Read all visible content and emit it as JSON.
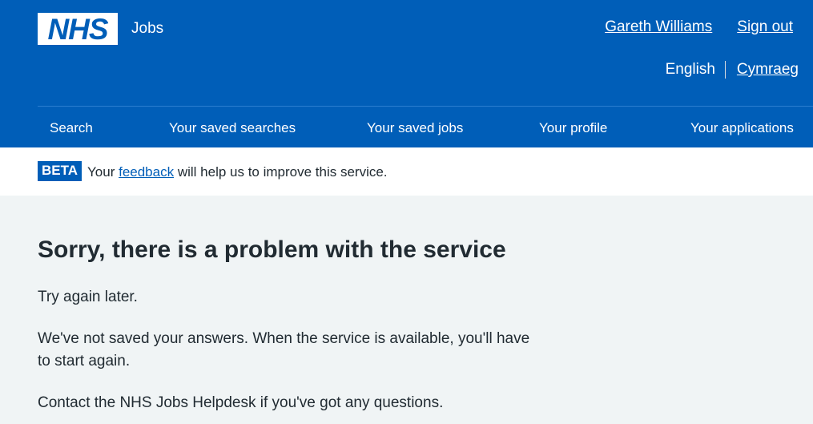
{
  "header": {
    "logo_text": "NHS",
    "service_name": "Jobs",
    "user_name": "Gareth Williams",
    "sign_out": "Sign out",
    "lang_current": "English",
    "lang_other": "Cymraeg"
  },
  "nav": {
    "items": [
      "Search",
      "Your saved searches",
      "Your saved jobs",
      "Your profile",
      "Your applications"
    ]
  },
  "beta": {
    "tag": "BETA",
    "text_before": "Your",
    "link": "feedback",
    "text_after": "will help us to improve this service."
  },
  "main": {
    "title": "Sorry, there is a problem with the service",
    "p1": "Try again later.",
    "p2": "We've not saved your answers. When the service is available, you'll have to start again.",
    "p3": "Contact the NHS Jobs Helpdesk if you've got any questions."
  },
  "colors": {
    "brand_blue": "#005eb8",
    "page_bg": "#f0f4f5",
    "text": "#212b32"
  }
}
